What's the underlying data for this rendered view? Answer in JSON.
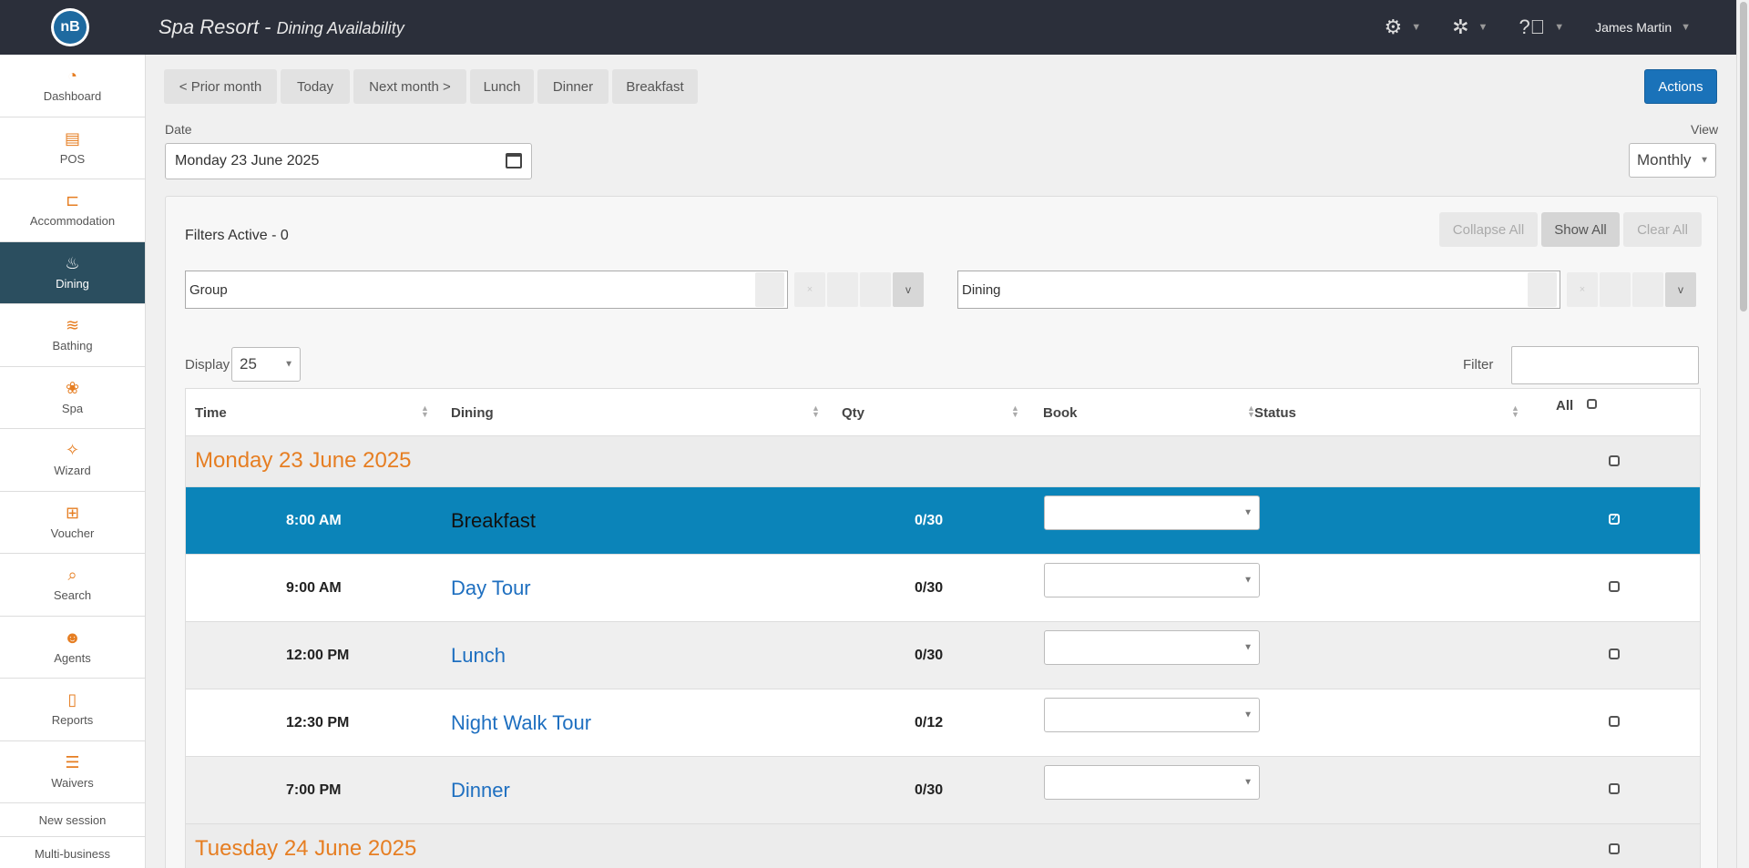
{
  "header": {
    "title": "Spa Resort",
    "separator": " - ",
    "subtitle": "Dining Availability",
    "logo_text": "nB",
    "user": "James Martin"
  },
  "sidebar": {
    "items": [
      {
        "label": "Dashboard",
        "icon": "dashboard-icon"
      },
      {
        "label": "POS",
        "icon": "register-icon"
      },
      {
        "label": "Accommodation",
        "icon": "bed-icon"
      },
      {
        "label": "Dining",
        "icon": "dining-icon",
        "active": true
      },
      {
        "label": "Bathing",
        "icon": "waves-icon"
      },
      {
        "label": "Spa",
        "icon": "lotus-icon"
      },
      {
        "label": "Wizard",
        "icon": "wand-icon"
      },
      {
        "label": "Voucher",
        "icon": "gift-icon"
      },
      {
        "label": "Search",
        "icon": "search-icon"
      },
      {
        "label": "Agents",
        "icon": "agents-icon"
      },
      {
        "label": "Reports",
        "icon": "report-icon"
      },
      {
        "label": "Waivers",
        "icon": "checklist-icon"
      }
    ],
    "links": [
      "New session",
      "Multi-business"
    ]
  },
  "toolbar": {
    "prior": "< Prior month",
    "today": "Today",
    "next": "Next month >",
    "lunch": "Lunch",
    "dinner": "Dinner",
    "breakfast": "Breakfast",
    "actions": "Actions"
  },
  "date": {
    "label": "Date",
    "value": "Monday 23 June 2025"
  },
  "view": {
    "label": "View",
    "value": "Monthly"
  },
  "filters": {
    "title": "Filters Active - 0",
    "collapse": "Collapse All",
    "show": "Show All",
    "clear": "Clear All",
    "group": "Group",
    "dining": "Dining",
    "x": "×",
    "v": "v"
  },
  "display": {
    "label": "Display",
    "value": "25"
  },
  "filter_label": "Filter",
  "table": {
    "headers": {
      "time": "Time",
      "dining": "Dining",
      "qty": "Qty",
      "book": "Book",
      "status": "Status",
      "all": "All"
    },
    "groups": [
      {
        "title": "Monday 23 June 2025",
        "rows": [
          {
            "time": "8:00 AM",
            "dining": "Breakfast",
            "qty": "0/30"
          },
          {
            "time": "9:00 AM",
            "dining": "Day Tour",
            "qty": "0/30"
          },
          {
            "time": "12:00 PM",
            "dining": "Lunch",
            "qty": "0/30"
          },
          {
            "time": "12:30 PM",
            "dining": "Night Walk Tour",
            "qty": "0/12"
          },
          {
            "time": "7:00 PM",
            "dining": "Dinner",
            "qty": "0/30"
          }
        ]
      },
      {
        "title": "Tuesday 24 June 2025"
      }
    ]
  }
}
